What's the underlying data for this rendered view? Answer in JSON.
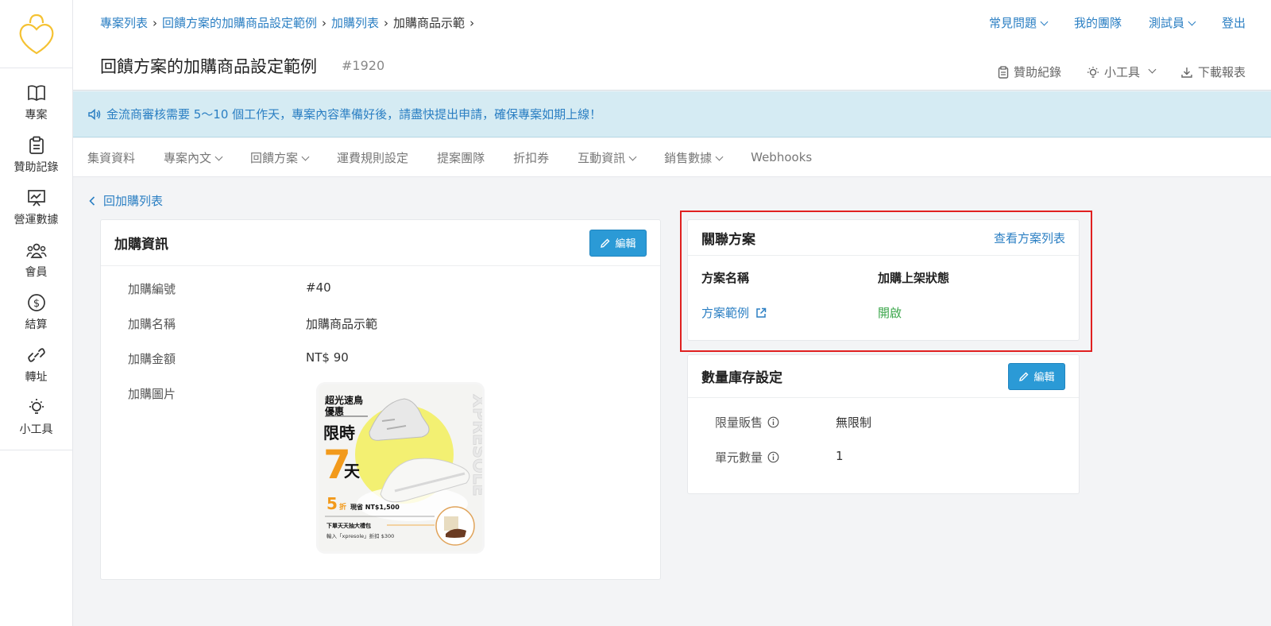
{
  "sidebar": {
    "items": [
      {
        "label": "專案",
        "icon": "book-icon"
      },
      {
        "label": "贊助記錄",
        "icon": "clipboard-icon"
      },
      {
        "label": "營運數據",
        "icon": "chart-board-icon"
      },
      {
        "label": "會員",
        "icon": "users-icon"
      },
      {
        "label": "結算",
        "icon": "dollar-icon"
      },
      {
        "label": "轉址",
        "icon": "link-icon"
      },
      {
        "label": "小工具",
        "icon": "lightbulb-icon"
      }
    ]
  },
  "breadcrumb": {
    "items": [
      "專案列表",
      "回饋方案的加購商品設定範例",
      "加購列表"
    ],
    "current": "加購商品示範"
  },
  "top_nav": {
    "faq": "常見問題",
    "my_team": "我的團隊",
    "user": "測試員",
    "logout": "登出"
  },
  "page": {
    "title": "回饋方案的加購商品設定範例",
    "id": "#1920"
  },
  "tools": {
    "sponsor_log": "贊助紀錄",
    "gadgets": "小工具",
    "download": "下載報表"
  },
  "notice": {
    "text": "金流商審核需要 5～10 個工作天，專案內容準備好後，請盡快提出申請，確保專案如期上線！"
  },
  "tabs": [
    {
      "label": "集資資料",
      "dropdown": false
    },
    {
      "label": "專案內文",
      "dropdown": true
    },
    {
      "label": "回饋方案",
      "dropdown": true
    },
    {
      "label": "運費規則設定",
      "dropdown": false
    },
    {
      "label": "提案團隊",
      "dropdown": false
    },
    {
      "label": "折扣券",
      "dropdown": false
    },
    {
      "label": "互動資訊",
      "dropdown": true
    },
    {
      "label": "銷售數據",
      "dropdown": true
    },
    {
      "label": "Webhooks",
      "dropdown": false
    }
  ],
  "back_link": "回加購列表",
  "addon_card": {
    "title": "加購資訊",
    "edit_label": "編輯",
    "fields": [
      {
        "key": "加購編號",
        "value": "#40"
      },
      {
        "key": "加購名稱",
        "value": "加購商品示範"
      },
      {
        "key": "加購金額",
        "value": "NT$ 90"
      },
      {
        "key": "加購圖片",
        "value": ""
      }
    ],
    "image": {
      "line1": "超光速鳥",
      "line2": "優惠",
      "line3": "限時",
      "days_num": "7",
      "days_unit": "天",
      "discount_num": "5",
      "discount_unit": "折",
      "discount_save": "現省 NT$1,500",
      "gift": "下單天天抽大禮包",
      "coupon": "輸入「xpresole」折扣 $300",
      "brand": "XPRESOLE"
    }
  },
  "related_card": {
    "title": "關聯方案",
    "view_link": "查看方案列表",
    "col_name": "方案名稱",
    "col_status": "加購上架狀態",
    "row_name": "方案範例",
    "row_status": "開啟",
    "status_color": "#3aa64a"
  },
  "stock_card": {
    "title": "數量庫存設定",
    "edit_label": "編輯",
    "fields": [
      {
        "key": "限量販售",
        "value": "無限制"
      },
      {
        "key": "單元數量",
        "value": "1"
      }
    ]
  },
  "colors": {
    "link": "#2b7fc3",
    "button": "#2b9ad6",
    "notice_bg": "#d5ebf3",
    "highlight": "#e02020"
  }
}
